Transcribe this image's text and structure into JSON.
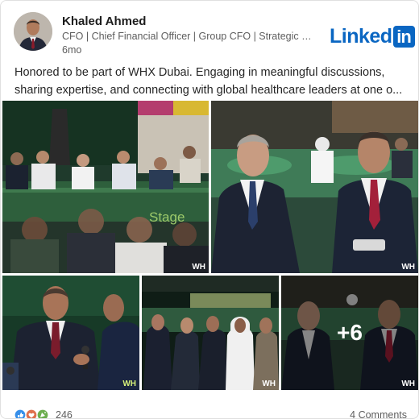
{
  "post": {
    "author_name": "Khaled Ahmed",
    "headline": "CFO | Chief Financial Officer | Group CFO | Strategic C...",
    "timestamp": "6mo",
    "body_line1": "Honored to be part of WHX Dubai. Engaging in meaningful discussions,",
    "body_line2": "sharing expertise, and connecting with global healthcare leaders at one o..."
  },
  "brand": {
    "word": "Linked",
    "badge": "in",
    "color": "#0a66c2"
  },
  "gallery": {
    "watermark": "WH",
    "more_label": "+6",
    "stage_sign": "Stage"
  },
  "engagement": {
    "reaction_icons": [
      "like-icon",
      "love-icon",
      "celebrate-icon"
    ],
    "reaction_count": "246",
    "comments_label": "4 Comments"
  }
}
